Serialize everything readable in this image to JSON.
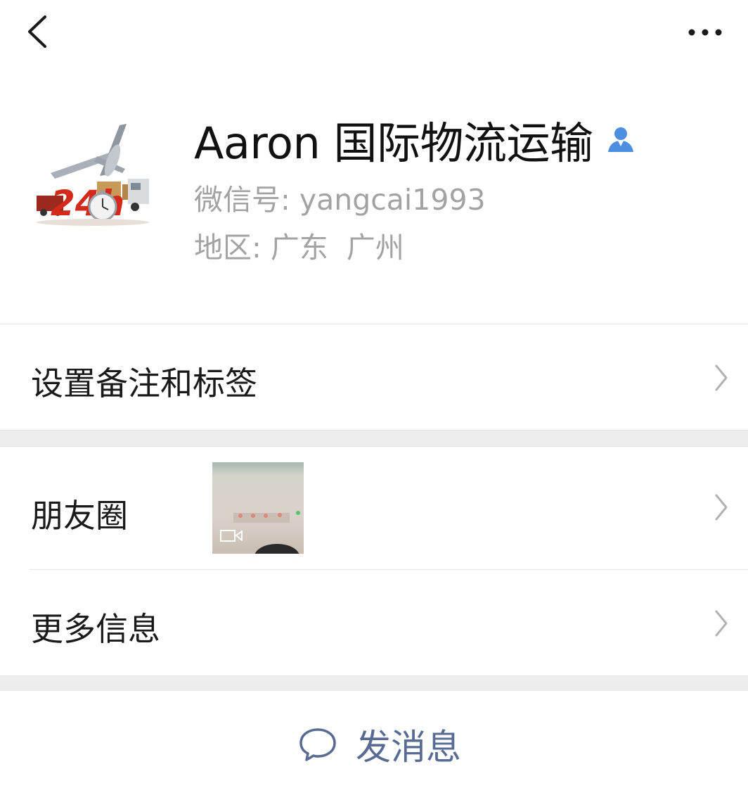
{
  "header": {
    "back_icon": "chevron-left-icon",
    "more_icon": "ellipsis-icon"
  },
  "profile": {
    "name": "Aaron 国际物流运输",
    "gender_icon": "person-icon",
    "wechat_id": "微信号: yangcai1993",
    "region_label": "地区: ",
    "region_province": "广东",
    "region_city": "广州",
    "avatar_text": "24h"
  },
  "menu": {
    "remark_label": "设置备注和标签",
    "moments_label": "朋友圈",
    "more_info_label": "更多信息"
  },
  "footer": {
    "send_message_label": "发消息",
    "chat_icon": "chat-bubble-icon"
  },
  "colors": {
    "accent_link": "#576b95",
    "secondary_text": "#a3a3a3",
    "gender_male": "#4c8fe0",
    "separator_bg": "#ededed"
  }
}
